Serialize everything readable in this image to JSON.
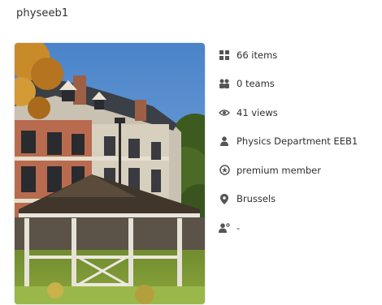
{
  "profile": {
    "username": "physeeb1"
  },
  "cover_image": {
    "icon": "building-photo"
  },
  "stats": [
    {
      "icon": "grid-icon",
      "text": "66 items"
    },
    {
      "icon": "users-icon",
      "text": "0 teams"
    },
    {
      "icon": "eye-icon",
      "text": "41 views"
    },
    {
      "icon": "person-icon",
      "text": "Physics Department EEB1"
    },
    {
      "icon": "badge-icon",
      "text": "premium member"
    },
    {
      "icon": "location-pin-icon",
      "text": "Brussels"
    },
    {
      "icon": "user-settings-icon",
      "text": "-"
    }
  ],
  "colors": {
    "icon": "#555555",
    "text": "#2f2f2f"
  }
}
